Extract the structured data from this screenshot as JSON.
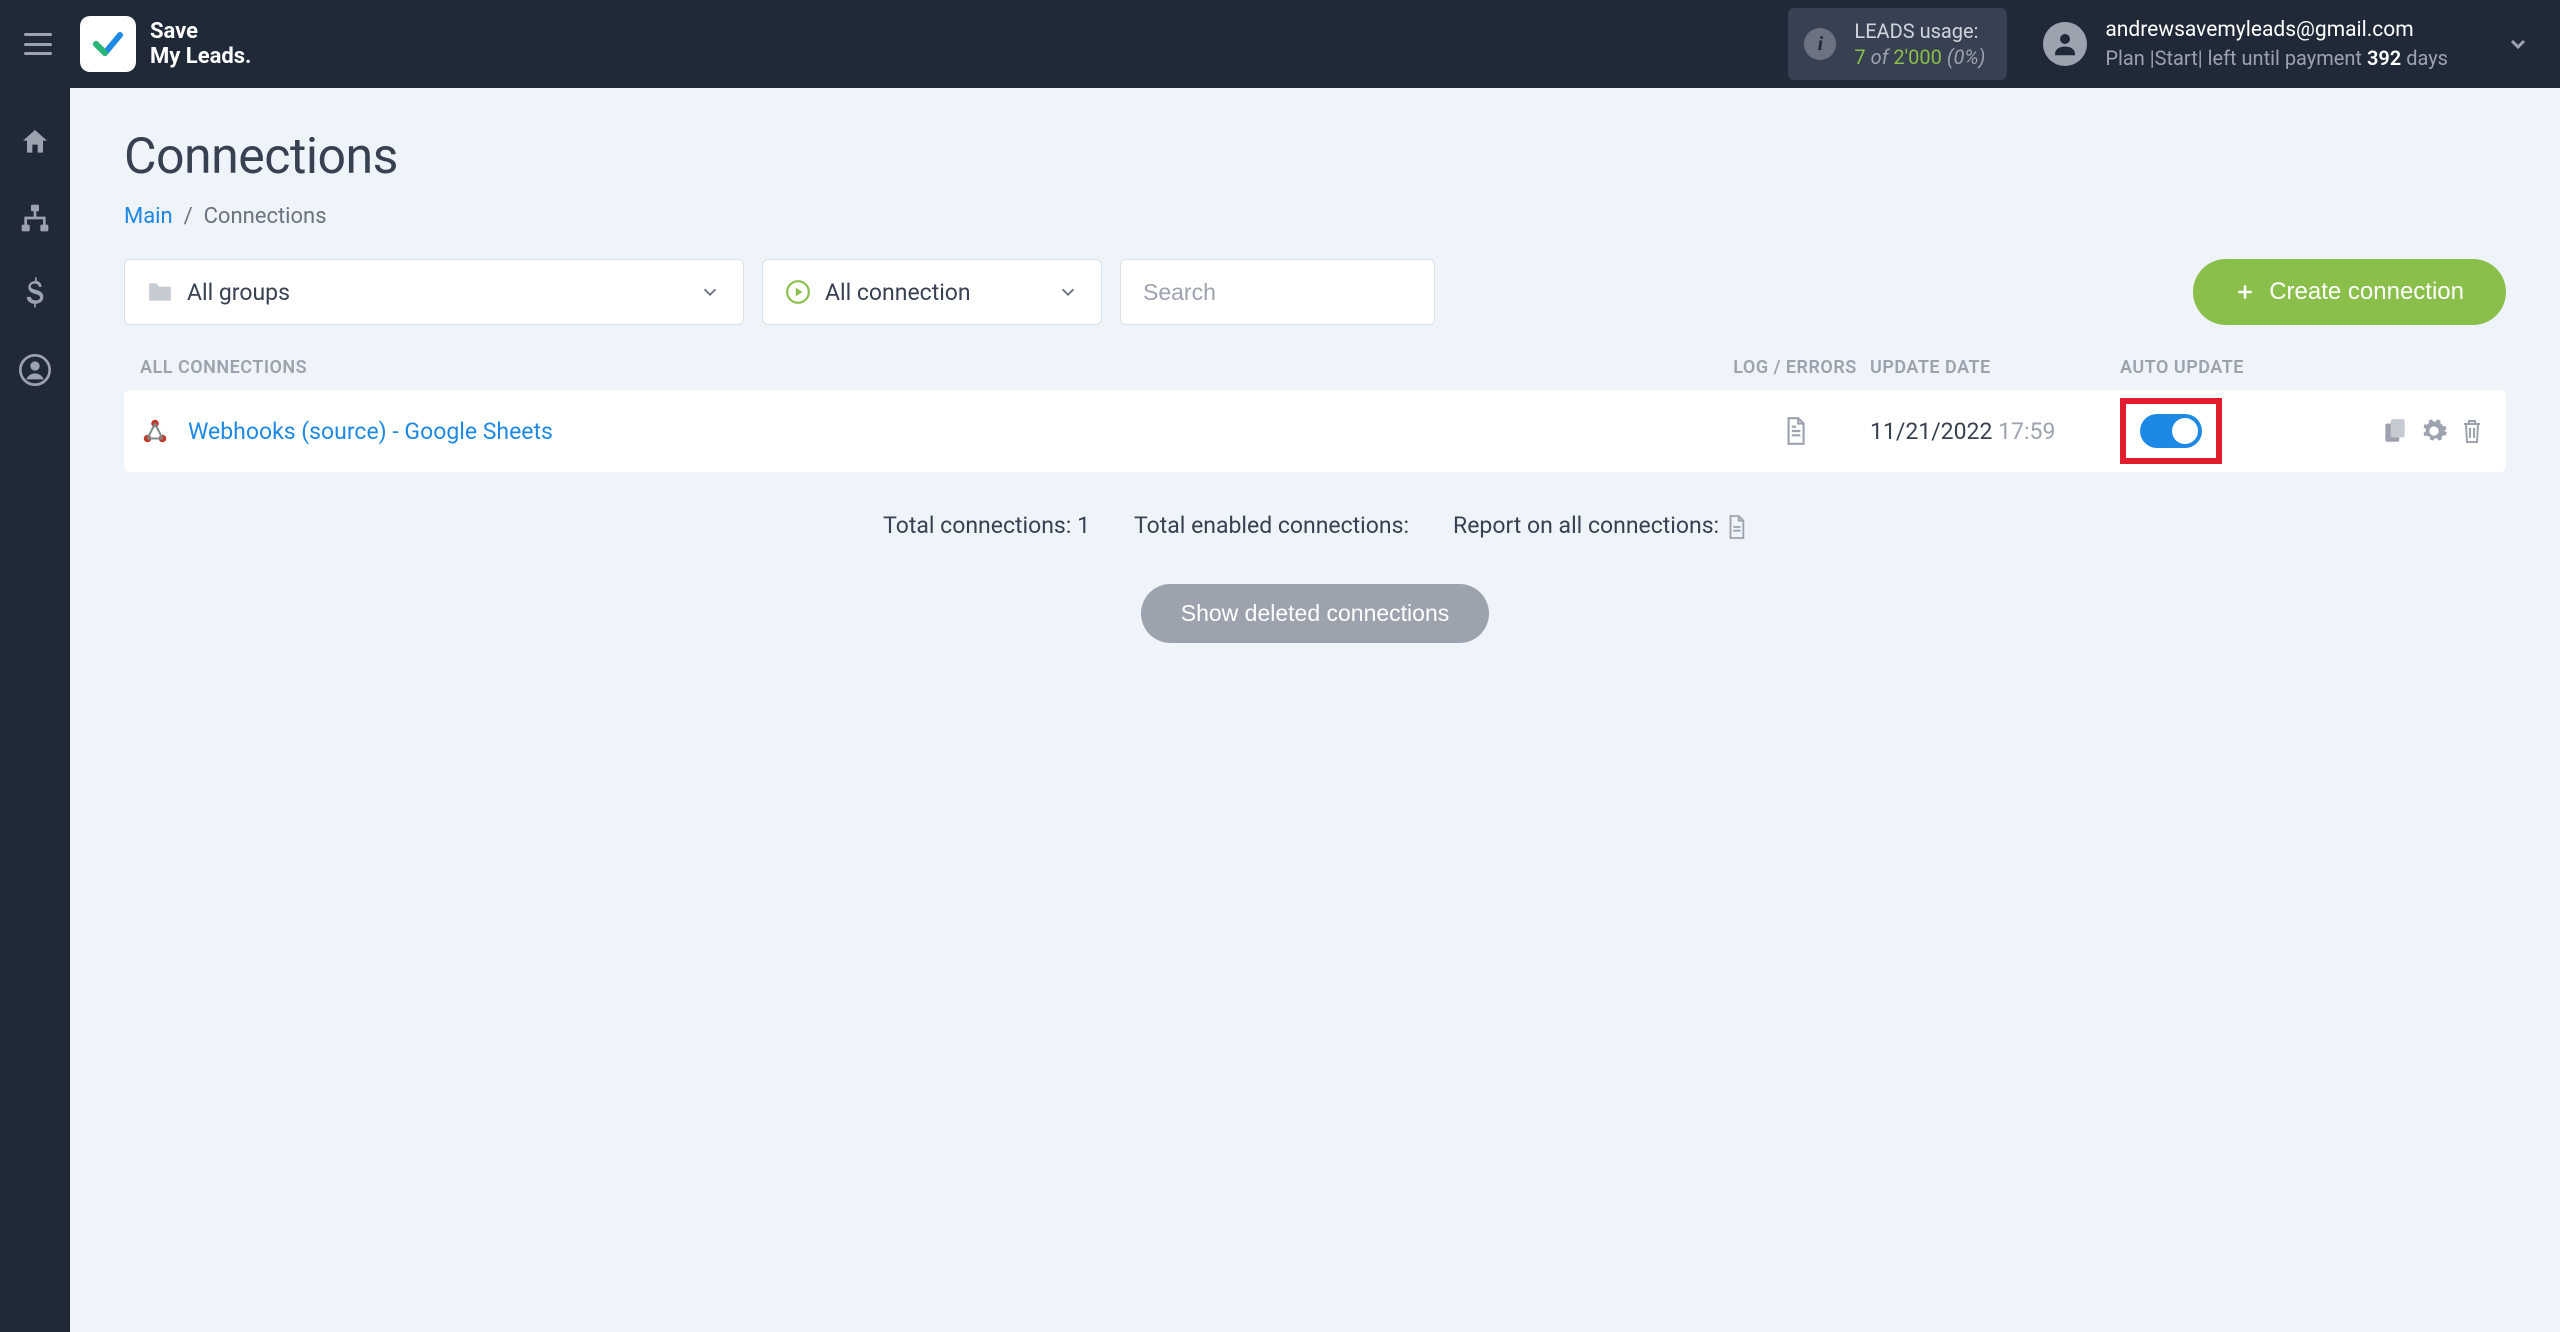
{
  "brand": {
    "line1": "Save",
    "line2": "My Leads."
  },
  "usage": {
    "label": "LEADS usage:",
    "count": "7",
    "of": "of",
    "total": "2'000",
    "pct": "(0%)"
  },
  "account": {
    "email": "andrewsavemyleads@gmail.com",
    "plan_prefix": "Plan",
    "plan_name": "|Start|",
    "plan_mid": "left until payment",
    "days": "392",
    "days_suffix": "days"
  },
  "page": {
    "title": "Connections",
    "breadcrumb_root": "Main",
    "breadcrumb_sep": "/",
    "breadcrumb_current": "Connections"
  },
  "filters": {
    "groups": "All groups",
    "status": "All connection",
    "search_placeholder": "Search"
  },
  "buttons": {
    "create": "Create connection",
    "show_deleted": "Show deleted connections"
  },
  "columns": {
    "name": "ALL CONNECTIONS",
    "log": "LOG / ERRORS",
    "date": "UPDATE DATE",
    "auto": "AUTO UPDATE"
  },
  "row": {
    "name": "Webhooks (source) - Google Sheets",
    "date": "11/21/2022",
    "time": "17:59"
  },
  "summary": {
    "total_label": "Total connections:",
    "total_value": "1",
    "enabled_label": "Total enabled connections:",
    "report_label": "Report on all connections:"
  }
}
